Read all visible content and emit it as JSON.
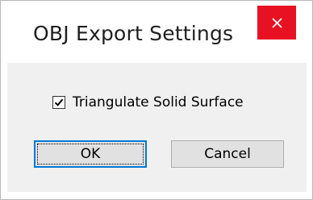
{
  "window": {
    "title": "OBJ Export Settings",
    "close_icon": "close-icon"
  },
  "options": {
    "triangulate": {
      "label": "Triangulate Solid Surface",
      "checked": true
    }
  },
  "buttons": {
    "ok_label": "OK",
    "cancel_label": "Cancel"
  },
  "colors": {
    "close_button": "#e81123",
    "focus_accent": "#0078d7",
    "client_background": "#f0f0f0"
  }
}
